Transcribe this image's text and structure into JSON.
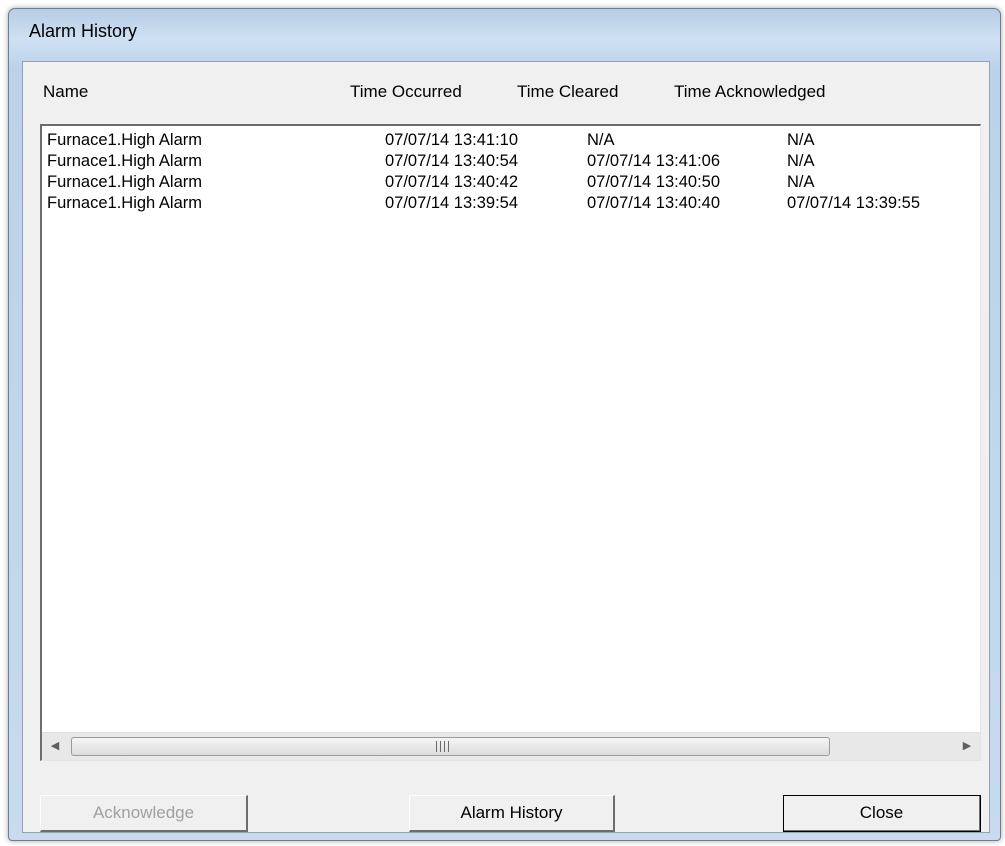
{
  "window": {
    "title": "Alarm History"
  },
  "columns": {
    "name": "Name",
    "time_occurred": "Time Occurred",
    "time_cleared": "Time Cleared",
    "time_acknowledged": "Time Acknowledged"
  },
  "rows": [
    {
      "name": "Furnace1.High Alarm",
      "occurred": "07/07/14 13:41:10",
      "cleared": "N/A",
      "acknowledged": "N/A"
    },
    {
      "name": "Furnace1.High Alarm",
      "occurred": "07/07/14 13:40:54",
      "cleared": "07/07/14 13:41:06",
      "acknowledged": "N/A"
    },
    {
      "name": "Furnace1.High Alarm",
      "occurred": "07/07/14 13:40:42",
      "cleared": "07/07/14 13:40:50",
      "acknowledged": "N/A"
    },
    {
      "name": "Furnace1.High Alarm",
      "occurred": "07/07/14 13:39:54",
      "cleared": "07/07/14 13:40:40",
      "acknowledged": "07/07/14 13:39:55"
    }
  ],
  "buttons": {
    "acknowledge": "Acknowledge",
    "alarm_history": "Alarm History",
    "close": "Close"
  },
  "icons": {
    "scroll_left": "left-arrow-icon",
    "scroll_right": "right-arrow-icon"
  }
}
